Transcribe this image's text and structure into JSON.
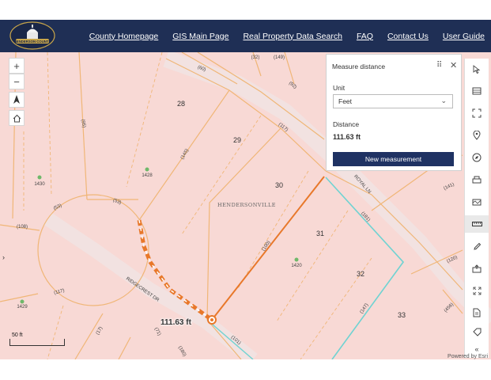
{
  "header": {
    "logo_text": "HENDERSON COUNTY",
    "nav": [
      "County Homepage",
      "GIS Main Page",
      "Real Property Data Search",
      "FAQ",
      "Contact Us",
      "User Guide"
    ]
  },
  "panel": {
    "title": "Measure distance",
    "unit_label": "Unit",
    "unit_value": "Feet",
    "distance_label": "Distance",
    "distance_value": "111.63 ft",
    "button": "New measurement"
  },
  "map": {
    "measure_label": "111.63 ft",
    "scale": "50 ft",
    "attribution": "Powered by Esri",
    "lots": [
      "28",
      "29",
      "30",
      "31",
      "32",
      "33"
    ],
    "subdivision": "HENDERSONVILLE",
    "streets": [
      "RIDGECREST DR",
      "ROYAL LN"
    ],
    "addresses": [
      "1430",
      "1428",
      "1420",
      "1429"
    ],
    "dims": [
      "(60)",
      "(32)",
      "(149)",
      "(95)",
      "(92)",
      "(117)",
      "(145)",
      "(141)",
      "(108)",
      "(53)",
      "(53)",
      "(181)",
      "(100)",
      "(120)",
      "(147)",
      "(101)",
      "(456)",
      "(117)",
      "(71)",
      "(17)",
      "(180)"
    ]
  },
  "colors": {
    "header": "#1f2f55",
    "measure": "#e8782a",
    "parcel_fill": "#f8d9d5",
    "highlight": "#6fd3d2"
  }
}
